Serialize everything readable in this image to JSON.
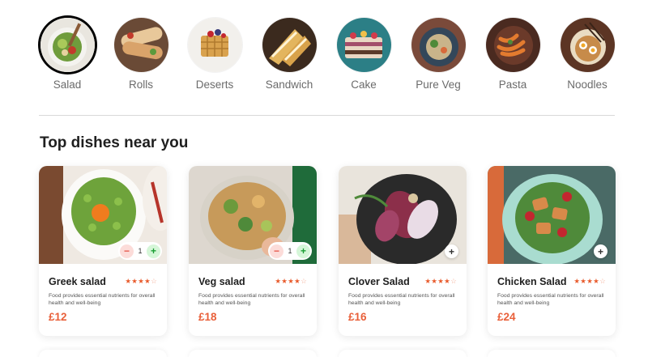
{
  "menu": {
    "active_index": 0,
    "items": [
      {
        "label": "Salad",
        "icon": "salad-bowl-image"
      },
      {
        "label": "Rolls",
        "icon": "rolls-image"
      },
      {
        "label": "Deserts",
        "icon": "waffle-dessert-image"
      },
      {
        "label": "Sandwich",
        "icon": "sandwich-image"
      },
      {
        "label": "Cake",
        "icon": "cake-image"
      },
      {
        "label": "Pure Veg",
        "icon": "veg-plate-image"
      },
      {
        "label": "Pasta",
        "icon": "pasta-image"
      },
      {
        "label": "Noodles",
        "icon": "noodles-image"
      }
    ]
  },
  "section": {
    "title": "Top dishes near you"
  },
  "dishes": [
    {
      "name": "Greek salad",
      "rating": 4,
      "max_rating": 5,
      "desc": "Food provides essential nutrients for overall health and well-being",
      "price": "£12",
      "qty": "1",
      "minus": "−",
      "plus": "+"
    },
    {
      "name": "Veg salad",
      "rating": 4,
      "max_rating": 5,
      "desc": "Food provides essential nutrients for overall health and well-being",
      "price": "£18",
      "qty": "1",
      "minus": "−",
      "plus": "+"
    },
    {
      "name": "Clover Salad",
      "rating": 4,
      "max_rating": 5,
      "desc": "Food provides essential nutrients for overall health and well-being",
      "price": "£16",
      "add": "+"
    },
    {
      "name": "Chicken Salad",
      "rating": 4,
      "max_rating": 5,
      "desc": "Food provides essential nutrients for overall health and well-being",
      "price": "£24",
      "add": "+"
    }
  ],
  "colors": {
    "accent": "#e9603a",
    "star": "#e85a2b",
    "minus_bg": "#fcdcd9",
    "plus_bg": "#d5f6d8"
  }
}
